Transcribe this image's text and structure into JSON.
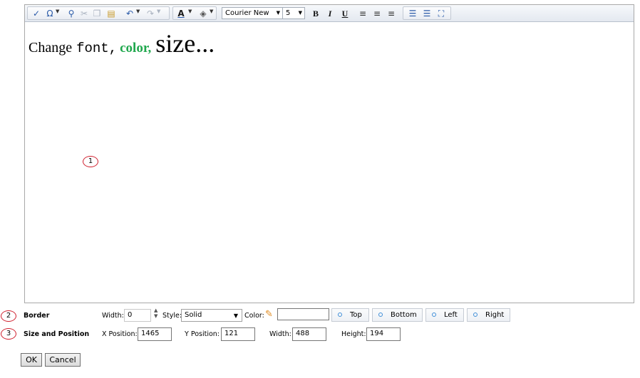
{
  "toolbar": {
    "font_name": "Courier New",
    "font_size": "5",
    "bold": "B",
    "italic": "I",
    "underline": "U",
    "font_color_letter": "A",
    "omega": "Ω"
  },
  "editor": {
    "content": {
      "change": "Change",
      "font": "font,",
      "color": "color,",
      "size": "size..."
    },
    "color_accent": "#21a84e"
  },
  "callouts": {
    "one": "1",
    "two": "2",
    "three": "3"
  },
  "border": {
    "label": "Border",
    "width_label": "Width:",
    "width_value": "0",
    "style_label": "Style:",
    "style_value": "Solid",
    "color_label": "Color:",
    "color_value": "",
    "sides": [
      "Top",
      "Bottom",
      "Left",
      "Right"
    ]
  },
  "position": {
    "label": "Size and Position",
    "x_label": "X Position:",
    "x_value": "1465",
    "y_label": "Y Position:",
    "y_value": "121",
    "width_label": "Width:",
    "width_value": "488",
    "height_label": "Height:",
    "height_value": "194"
  },
  "buttons": {
    "ok": "OK",
    "cancel": "Cancel"
  }
}
